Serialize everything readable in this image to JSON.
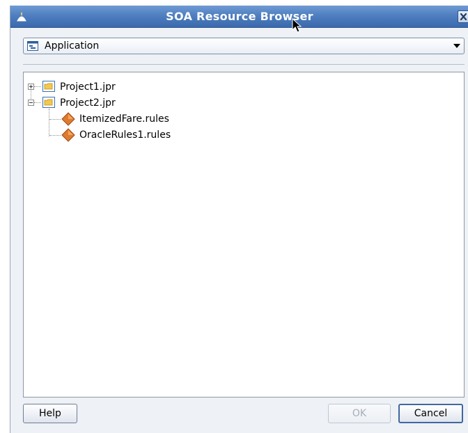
{
  "window": {
    "title": "SOA Resource Browser",
    "close_glyph": "x"
  },
  "selector": {
    "selected": "Application",
    "icon": "application-icon"
  },
  "tree": {
    "items": [
      {
        "label": "Project1.jpr",
        "icon": "folder-icon",
        "state": "collapsed"
      },
      {
        "label": "Project2.jpr",
        "icon": "folder-icon",
        "state": "expanded"
      },
      {
        "label": "ItemizedFare.rules",
        "icon": "rules-icon"
      },
      {
        "label": "OracleRules1.rules",
        "icon": "rules-icon"
      }
    ]
  },
  "buttons": {
    "help": "Help",
    "ok": "OK",
    "cancel": "Cancel"
  },
  "colors": {
    "titlebar": "#4f7fc0",
    "rules_icon": "#e07a2e",
    "folder_icon": "#f2c94c"
  }
}
